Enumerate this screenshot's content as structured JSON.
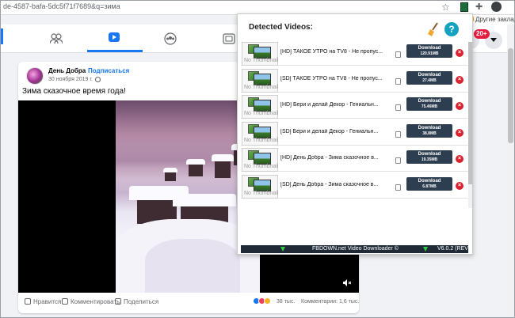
{
  "browser": {
    "url": "de-4587-bafa-5dc5f71f7689&q=зима",
    "bookmarks_label": "Другие закладки",
    "ext_color": "#1e6e3c"
  },
  "fb_nav": {
    "active_tab": "video",
    "notification_count": "20+",
    "accent": "#1877f2"
  },
  "post": {
    "author": "День Добра",
    "subscribe": "Подписаться",
    "date": "30 ноября 2019 г. ·",
    "text": "Зима сказочное время года!",
    "actions": {
      "like": "Нравится",
      "comment": "Комментировать",
      "share": "Поделиться"
    },
    "views": "38 тыс.",
    "comments": "Комментарии: 1,6 тыс."
  },
  "popup": {
    "title": "Detected Videos:",
    "thumb_label": "No Thumbnail",
    "download_label": "Download",
    "items": [
      {
        "title": "[HD] ТАКОЕ УТРО на TV8 - Не пропус...",
        "size": "120.91MB"
      },
      {
        "title": "[SD] ТАКОЕ УТРО на TV8 - Не пропус...",
        "size": "27.4MB"
      },
      {
        "title": "[HD] Бери и делай Декор - Гениальн...",
        "size": "75.46MB"
      },
      {
        "title": "[SD] Бери и делай Декор - Гениальн...",
        "size": "38.8MB"
      },
      {
        "title": "[HD] День Добра - Зима сказочное в...",
        "size": "19.35MB"
      },
      {
        "title": "[SD] День Добра - Зима сказочное в...",
        "size": "6.87MB"
      }
    ],
    "footer_text": "FBDOWN.net Video Downloader ©",
    "footer_version": "V6.0.2 (REV)",
    "colors": {
      "button": "#2c3e50",
      "delete": "#d9232f",
      "help": "#12a3c2"
    }
  }
}
